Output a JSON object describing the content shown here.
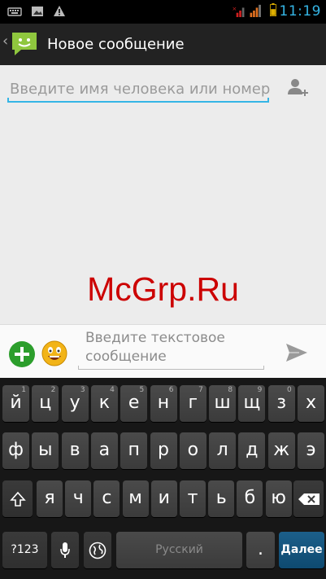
{
  "status_bar": {
    "time": "11:19"
  },
  "action_bar": {
    "title": "Новое сообщение"
  },
  "recipient": {
    "placeholder": "Введите имя человека или номер"
  },
  "watermark": "McGrp.Ru",
  "compose": {
    "placeholder": "Введите текстовое сообщение"
  },
  "keyboard": {
    "row1": [
      {
        "label": "й",
        "hint": "1"
      },
      {
        "label": "ц",
        "hint": "2"
      },
      {
        "label": "у",
        "hint": "3"
      },
      {
        "label": "к",
        "hint": "4"
      },
      {
        "label": "е",
        "hint": "5"
      },
      {
        "label": "н",
        "hint": "6"
      },
      {
        "label": "г",
        "hint": "7"
      },
      {
        "label": "ш",
        "hint": "8"
      },
      {
        "label": "щ",
        "hint": "9"
      },
      {
        "label": "з",
        "hint": "0"
      },
      {
        "label": "х",
        "hint": ""
      }
    ],
    "row2": [
      {
        "label": "ф"
      },
      {
        "label": "ы"
      },
      {
        "label": "в"
      },
      {
        "label": "а"
      },
      {
        "label": "п"
      },
      {
        "label": "р"
      },
      {
        "label": "о"
      },
      {
        "label": "л"
      },
      {
        "label": "д"
      },
      {
        "label": "ж"
      },
      {
        "label": "э"
      }
    ],
    "row3": [
      {
        "label": "я"
      },
      {
        "label": "ч"
      },
      {
        "label": "с"
      },
      {
        "label": "м"
      },
      {
        "label": "и"
      },
      {
        "label": "т"
      },
      {
        "label": "ь"
      },
      {
        "label": "б"
      },
      {
        "label": "ю"
      }
    ],
    "symbols_label": "?123",
    "space_label": "Русский",
    "period_label": ".",
    "action_label": "Далее"
  },
  "icons": [
    "keyboard-icon",
    "image-icon",
    "warning-icon",
    "signal-icon",
    "battery-icon",
    "messaging-app-icon",
    "add-contact-icon",
    "attach-plus-icon",
    "emoji-icon",
    "send-icon",
    "shift-icon",
    "backspace-icon",
    "mic-icon",
    "globe-icon"
  ]
}
